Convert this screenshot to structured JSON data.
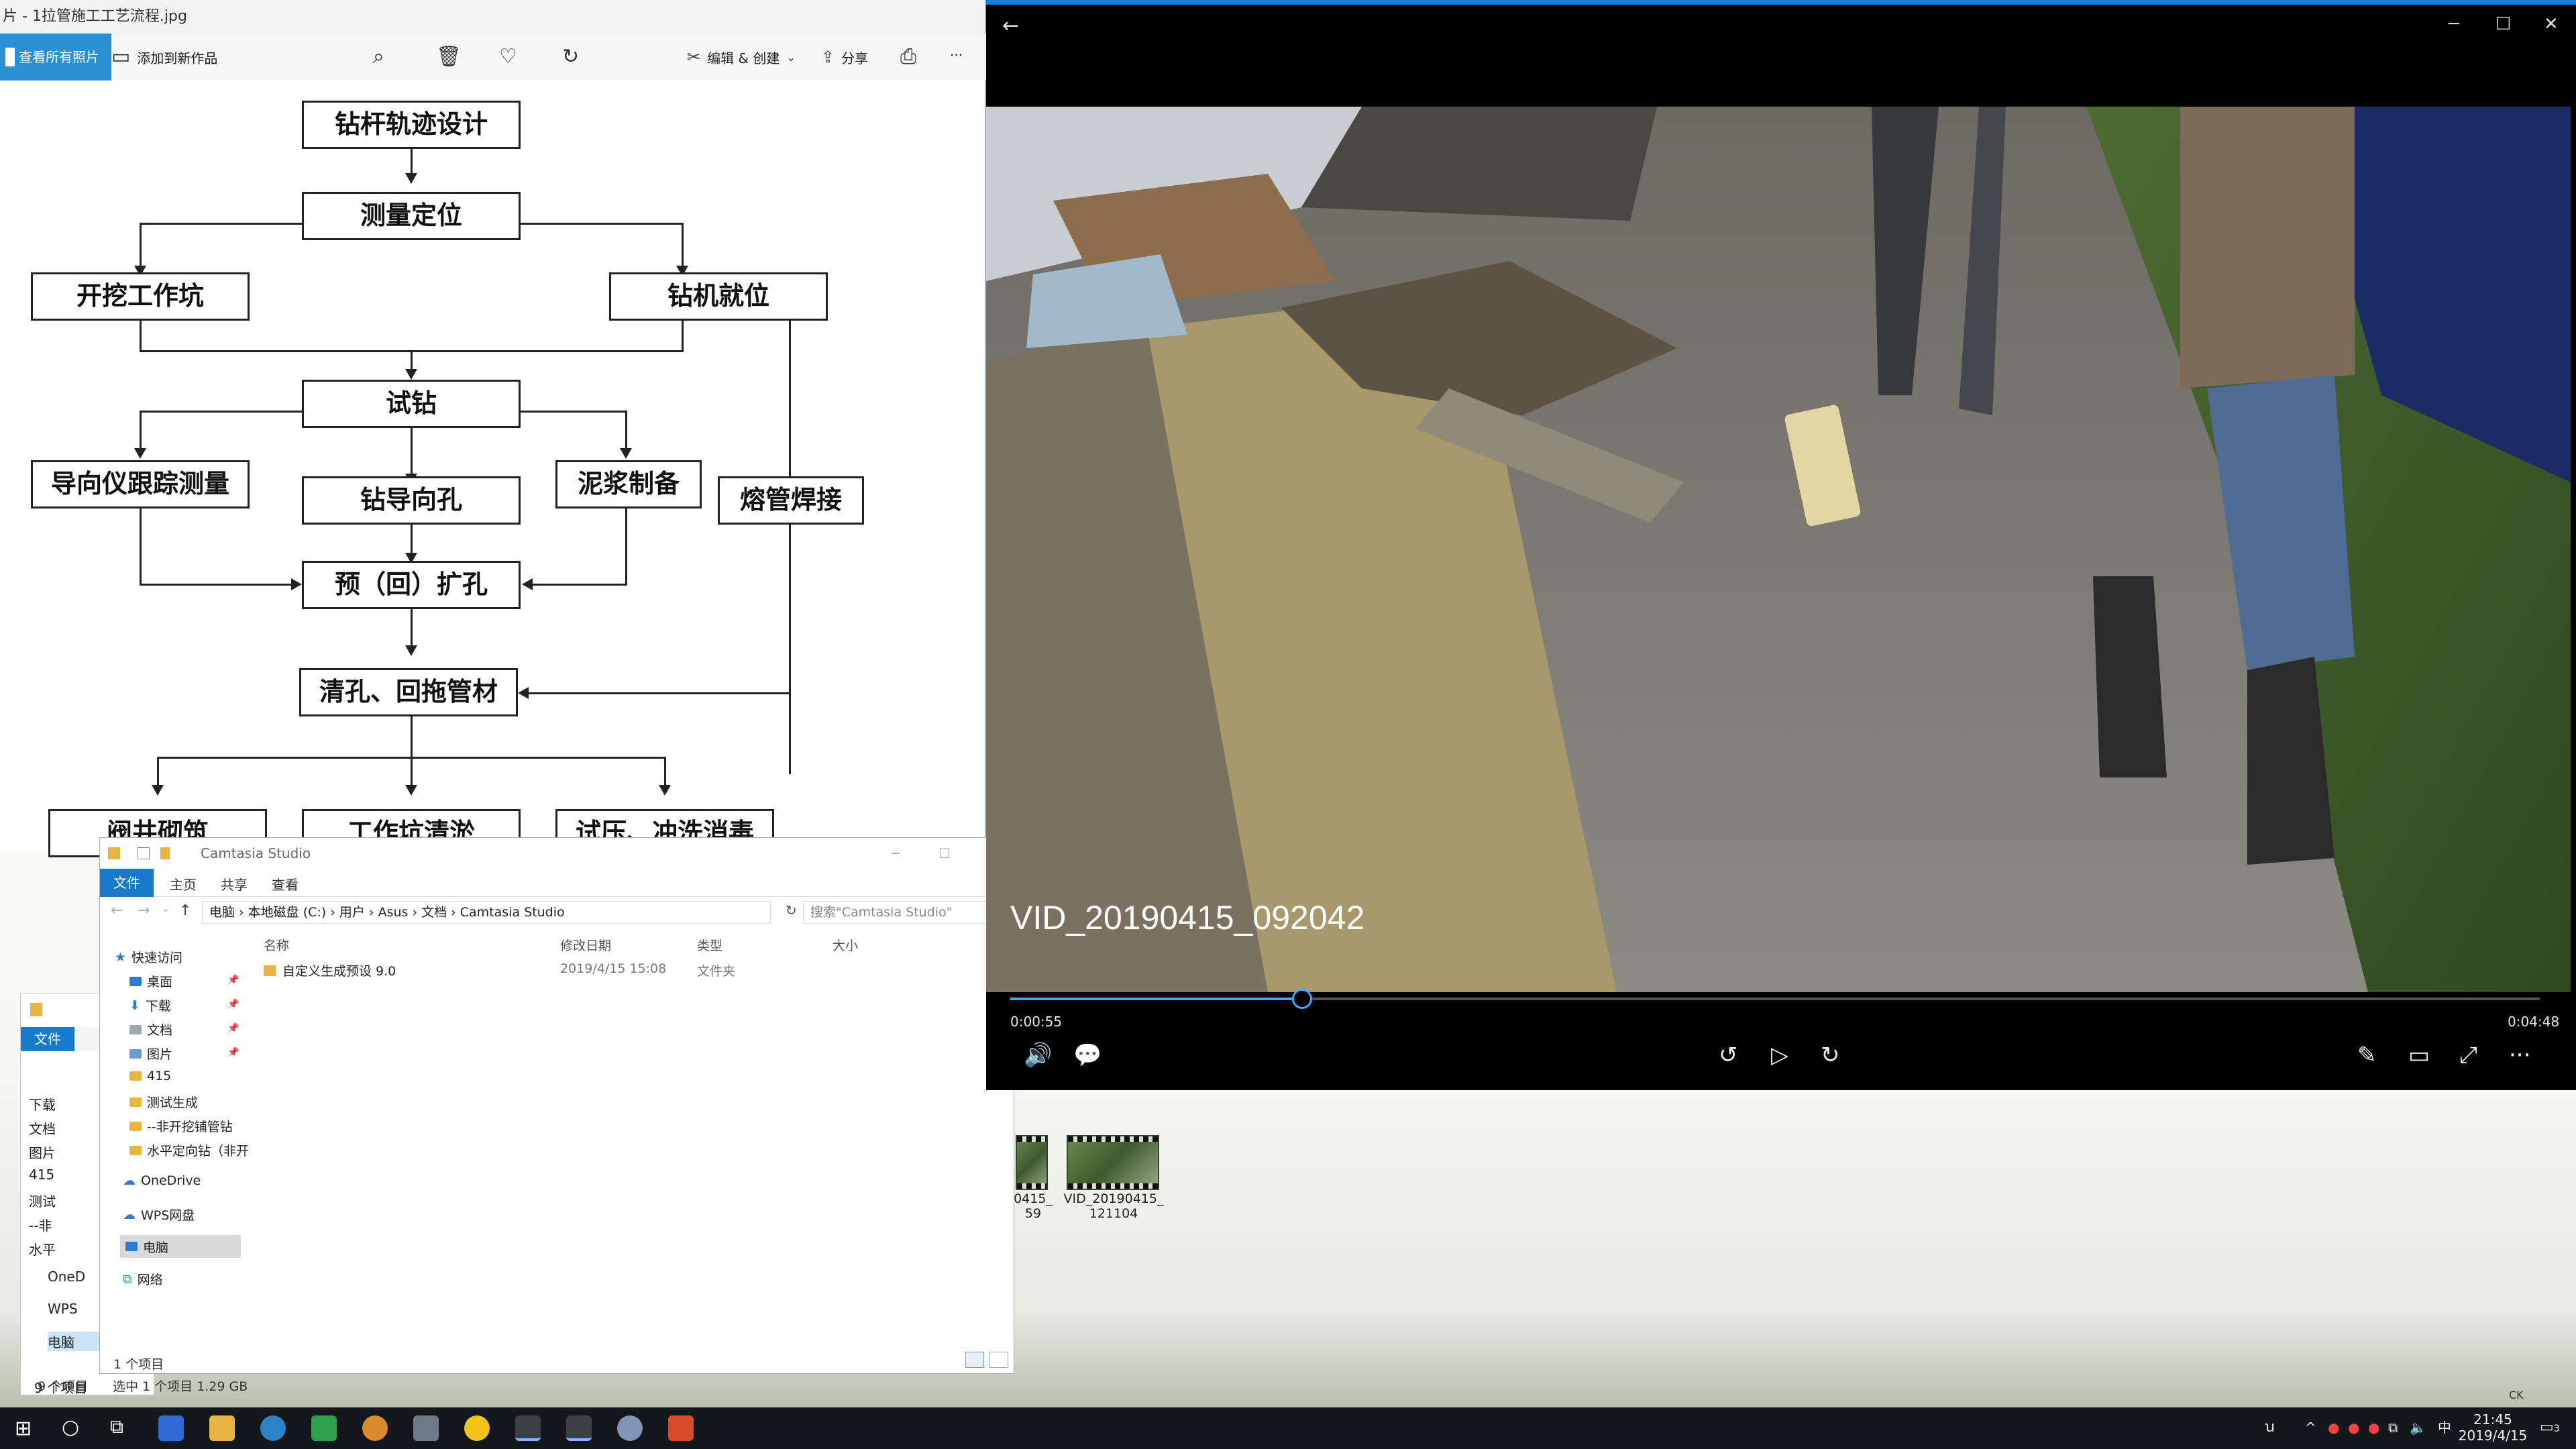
{
  "photos": {
    "title": "片 - 1拉管施工工艺流程.jpg",
    "see_all": "查看所有照片",
    "add_to_creation": "添加到新作品",
    "edit_create": "编辑 & 创建",
    "share": "分享",
    "more": "···"
  },
  "flowchart": {
    "track_design": "钻杆轨迹设计",
    "survey": "测量定位",
    "excavate_pit": "开挖工作坑",
    "rig_in_place": "钻机就位",
    "trial_drill": "试钻",
    "guide_tracking": "导向仪跟踪测量",
    "pilot_hole": "钻导向孔",
    "mud_prep": "泥浆制备",
    "pipe_welding": "熔管焊接",
    "reaming": "预（回）扩孔",
    "pullback": "清孔、回拖管材",
    "well_build": "阀井砌筑",
    "pit_clean": "工作坑清淤",
    "pressure_test": "试压、冲洗消毒"
  },
  "player": {
    "video_title": "VID_20190415_092042",
    "current_time": "0:00:55",
    "total_time": "0:04:48",
    "progress": 0.191
  },
  "thumbnails": {
    "left_label_1": "0415_",
    "left_label_2": "59",
    "right_label_1": "VID_20190415_",
    "right_label_2": "121104"
  },
  "explorer_bg": {
    "file_tab": "文件",
    "items": [
      "下载",
      "文档",
      "图片",
      "415",
      "测试",
      "--非",
      "水平"
    ],
    "onedrive": "OneD",
    "wps": "WPS",
    "pc": "电脑",
    "net": "网络",
    "status": "9 个项目"
  },
  "explorer": {
    "title": "Camtasia Studio",
    "tab_file": "文件",
    "tab_home": "主页",
    "tab_share": "共享",
    "tab_view": "查看",
    "address": "电脑 › 本地磁盘 (C:) › 用户 › Asus › 文档 › Camtasia Studio",
    "search_placeholder": "搜索\"Camtasia Studio\"",
    "col_name": "名称",
    "col_modified": "修改日期",
    "col_type": "类型",
    "col_size": "大小",
    "quick_access": "快速访问",
    "nav_desktop": "桌面",
    "nav_downloads": "下载",
    "nav_docs": "文档",
    "nav_pictures": "图片",
    "nav_415": "415",
    "nav_test": "测试生成",
    "nav_nondig": "--非开挖铺管钻",
    "nav_hdd": "水平定向钻（非开",
    "nav_onedrive": "OneDrive",
    "nav_wps": "WPS网盘",
    "nav_pc": "电脑",
    "nav_network": "网络",
    "row_name": "自定义生成预设 9.0",
    "row_date": "2019/4/15 15:08",
    "row_type": "文件夹",
    "status_count": "1 个项目",
    "status_selected": "选中 1 个项目  1.29 GB"
  },
  "taskbar": {
    "ime": "ꭒ",
    "time": "21:45",
    "date": "2019/4/15",
    "notif": "3",
    "lang_box": "CK"
  }
}
